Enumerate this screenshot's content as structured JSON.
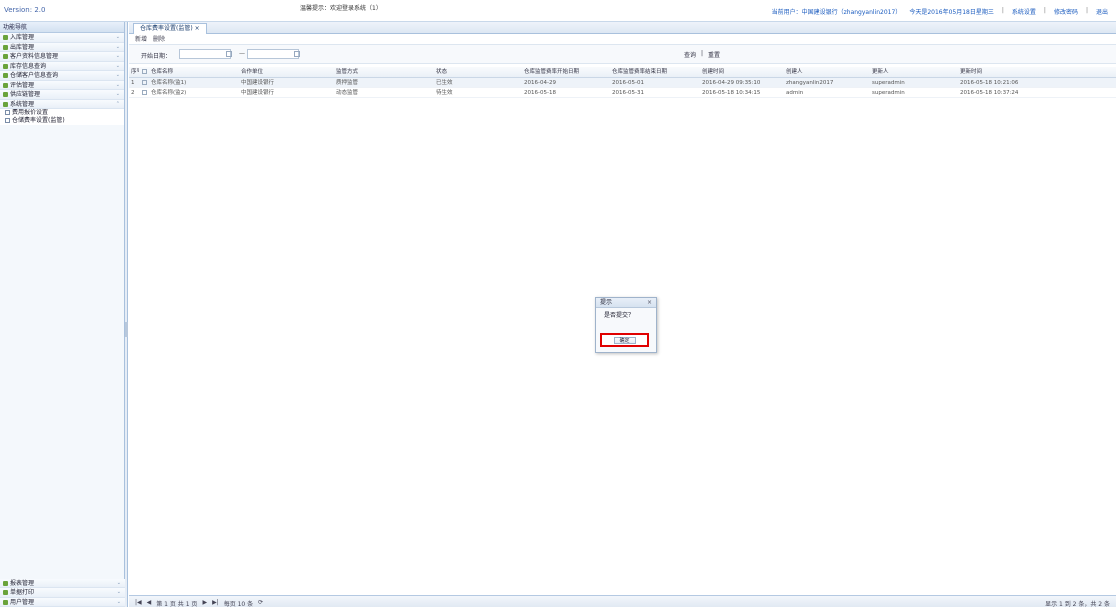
{
  "app": {
    "version": "Version: 2.0",
    "notice": "温馨提示：欢迎登录系统（1）"
  },
  "header_links": {
    "user": "当前用户：中国建设银行（zhangyanlin2017）",
    "date": "今天是2016年05月18日星期三",
    "settings": "系统设置",
    "password": "修改密码",
    "logout": "退出"
  },
  "sidebar": {
    "title": "功能导航",
    "items": [
      {
        "label": "入库管理"
      },
      {
        "label": "出库管理"
      },
      {
        "label": "客户资料信息管理"
      },
      {
        "label": "库存信息查询"
      },
      {
        "label": "仓储客户信息查询"
      },
      {
        "label": "评估管理"
      },
      {
        "label": "供应链管理"
      },
      {
        "label": "系统管理"
      }
    ],
    "sub_items": [
      {
        "label": "费用报价设置"
      },
      {
        "label": "仓储费率设置(监管)"
      }
    ],
    "bottom_items": [
      {
        "label": "报表管理"
      },
      {
        "label": "单据打印"
      },
      {
        "label": "用户管理"
      }
    ]
  },
  "tabs": [
    {
      "label": "仓库费率设置(监管) ×"
    }
  ],
  "toolbar": {
    "add": "新增",
    "delete": "删除"
  },
  "filter": {
    "label": "开始日期：",
    "dash": "—",
    "search": "查询",
    "reset": "重置"
  },
  "grid": {
    "columns": [
      "序号",
      "仓库名称",
      "合作单位",
      "监管方式",
      "状态",
      "仓库监管费率开始日期",
      "仓库监管费率结束日期",
      "创建时间",
      "创建人",
      "更新人",
      "更新时间"
    ],
    "rows": [
      [
        "1",
        "仓库名称(监1)",
        "中国建设银行",
        "质押监管",
        "已生效",
        "2016-04-29",
        "2016-05-01",
        "2016-04-29 09:35:10",
        "zhangyanlin2017",
        "superadmin",
        "2016-05-18 10:21:06"
      ],
      [
        "2",
        "仓库名称(监2)",
        "中国建设银行",
        "动态监管",
        "待生效",
        "2016-05-18",
        "2016-05-31",
        "2016-05-18 10:34:15",
        "admin",
        "superadmin",
        "2016-05-18 10:37:24"
      ]
    ]
  },
  "pager": {
    "page": "第 1 页 共 1 页",
    "size": "每页 10 条",
    "summary": "显示 1 到 2 条，共 2 条"
  },
  "context_menu": {
    "title": "提示",
    "message": "是否提交？",
    "confirm": "确定"
  }
}
